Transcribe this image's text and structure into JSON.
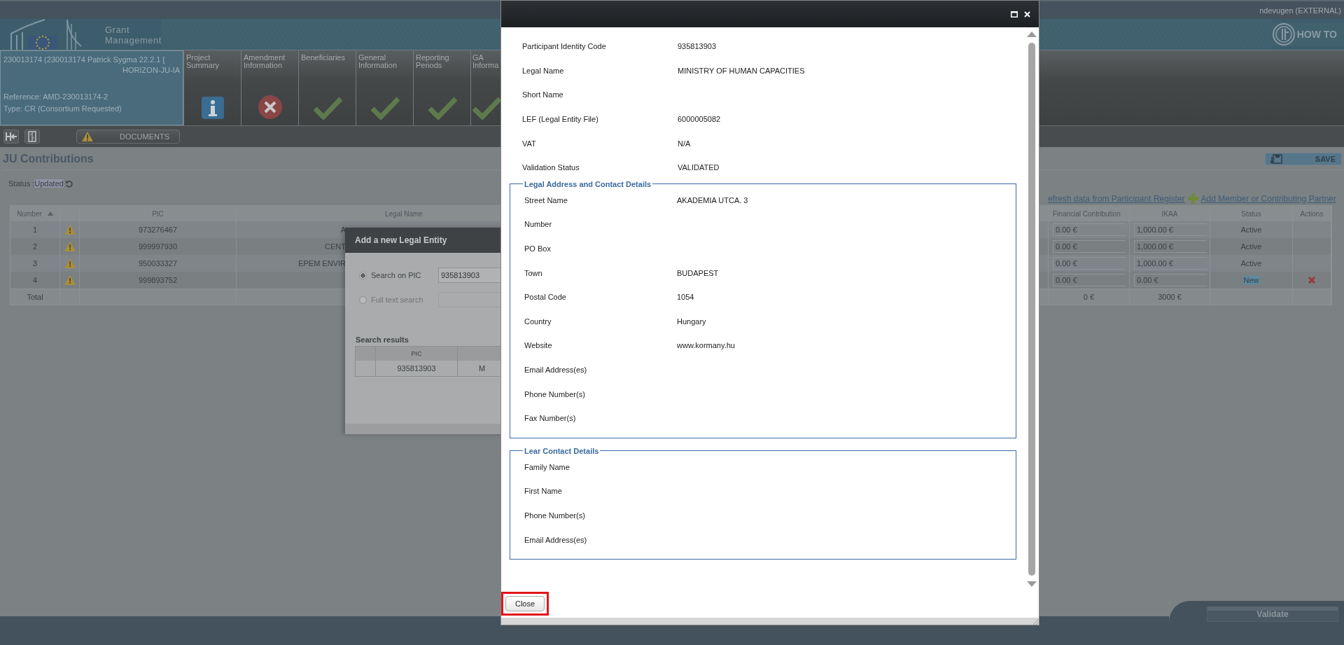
{
  "top_bar": {
    "user": "ndevugen (EXTERNAL)"
  },
  "header": {
    "app_name": "Grant Management",
    "how_to": "HOW TO"
  },
  "project": {
    "title": "230013174 (230013174 Patrick Sygma 22.2.1 [",
    "programme": "HORIZON-JU-IA",
    "reference": "Reference: AMD-230013174-2",
    "type": "Type: CR (Consortium Requested)"
  },
  "steps": [
    {
      "label": "Project Summary",
      "kind": "info"
    },
    {
      "label": "Amendment Information",
      "kind": "error"
    },
    {
      "label": "Beneficiaries",
      "kind": "done"
    },
    {
      "label": "General Information",
      "kind": "done"
    },
    {
      "label": "Reporting Periods",
      "kind": "done"
    },
    {
      "label": "GA Informa",
      "kind": "done"
    }
  ],
  "toolbar": {
    "documents": "DOCUMENTS"
  },
  "page": {
    "title": "JU Contributions",
    "status_label": "Status :",
    "status_value": "Updated",
    "save": "SAVE",
    "refresh_link": "efresh data from Participant Register",
    "add_link": "Add Member or Contributing Partner"
  },
  "table": {
    "columns": {
      "number": "Number",
      "pic": "PIC",
      "legal_name": "Legal Name",
      "financial": "Financial Contribution",
      "ikaa": "IKAA",
      "status": "Status",
      "actions": "Actions"
    },
    "rows": [
      {
        "number": "1",
        "warning": true,
        "pic": "973276467",
        "legal_name": "A",
        "financial": "0.00 €",
        "ikaa": "1,000.00 €",
        "status": "Active",
        "highlighted": false,
        "removable": false
      },
      {
        "number": "2",
        "warning": true,
        "pic": "999997930",
        "legal_name": "CENT",
        "financial": "0.00 €",
        "ikaa": "1,000.00 €",
        "status": "Active",
        "highlighted": false,
        "removable": false
      },
      {
        "number": "3",
        "warning": true,
        "pic": "950033327",
        "legal_name": "EPEM ENVIR",
        "financial": "0.00 €",
        "ikaa": "1,000.00 €",
        "status": "Active",
        "highlighted": false,
        "removable": false
      },
      {
        "number": "4",
        "warning": true,
        "pic": "999893752",
        "financial": "0.00 €",
        "ikaa": "0.00 €",
        "status": "New",
        "highlighted": true,
        "removable": true
      }
    ],
    "total": {
      "label": "Total",
      "financial": "0 €",
      "ikaa": "3000 €"
    }
  },
  "add_entity_dialog": {
    "title": "Add a new Legal Entity",
    "options": [
      {
        "label": "Search on PIC",
        "selected": true,
        "disabled": false,
        "value": "935813903"
      },
      {
        "label": "Full text search",
        "selected": false,
        "disabled": true
      }
    ],
    "results_title": "Search results",
    "results_columns": [
      "PIC"
    ],
    "results_rows": [
      {
        "pic": "935813903",
        "column_2": "M"
      }
    ]
  },
  "details_dialog": {
    "fields": [
      {
        "label": "Participant Identity Code",
        "value": "935813903"
      },
      {
        "label": "Legal Name",
        "value": "MINISTRY OF HUMAN CAPACITIES"
      },
      {
        "label": "Short Name"
      },
      {
        "label": "LEF (Legal Entity File)",
        "value": "6000005082"
      },
      {
        "label": "VAT",
        "value": "N/A"
      },
      {
        "label": "Validation Status",
        "value": "VALIDATED"
      }
    ],
    "sections": [
      {
        "title": "Legal Address and Contact Details",
        "fields": [
          {
            "label": "Street Name",
            "value": "AKADEMIA UTCA. 3"
          },
          {
            "label": "Number"
          },
          {
            "label": "PO Box"
          },
          {
            "label": "Town",
            "value": "BUDAPEST"
          },
          {
            "label": "Postal Code",
            "value": "1054"
          },
          {
            "label": "Country",
            "value": "Hungary"
          },
          {
            "label": "Website",
            "value": "www.kormany.hu"
          },
          {
            "label": "Email Address(es)"
          },
          {
            "label": "Phone Number(s)"
          },
          {
            "label": "Fax Number(s)"
          }
        ]
      },
      {
        "title": "Lear Contact Details",
        "fields": [
          {
            "label": "Family Name"
          },
          {
            "label": "First Name"
          },
          {
            "label": "Phone Number(s)"
          },
          {
            "label": "Email Address(es)"
          }
        ]
      }
    ],
    "close": {
      "label": "Close",
      "highlighted": true
    }
  },
  "footer": {
    "validate": "Validate"
  }
}
